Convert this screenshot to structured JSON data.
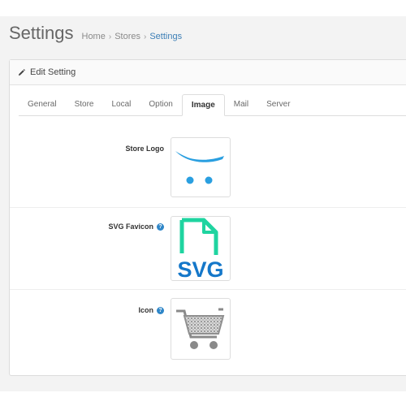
{
  "header": {
    "title": "Settings",
    "breadcrumb": [
      "Home",
      "Stores",
      "Settings"
    ]
  },
  "panel": {
    "heading": "Edit Setting",
    "heading_icon": "pencil-icon"
  },
  "tabs": [
    {
      "label": "General"
    },
    {
      "label": "Store"
    },
    {
      "label": "Local"
    },
    {
      "label": "Option"
    },
    {
      "label": "Image",
      "active": true
    },
    {
      "label": "Mail"
    },
    {
      "label": "Server"
    }
  ],
  "fields": [
    {
      "label": "Store Logo",
      "help": false,
      "image": "opencart-logo"
    },
    {
      "label": "SVG Favicon",
      "help": true,
      "image": "svg-file-icon",
      "image_text": "SVG"
    },
    {
      "label": "Icon",
      "help": true,
      "image": "shopping-cart-icon"
    }
  ],
  "colors": {
    "accent": "#3d7fb6",
    "help": "#2e86c8",
    "logo_blue": "#2a9fe0",
    "svg_green": "#1fd4a0",
    "svg_blue": "#1477c9"
  }
}
